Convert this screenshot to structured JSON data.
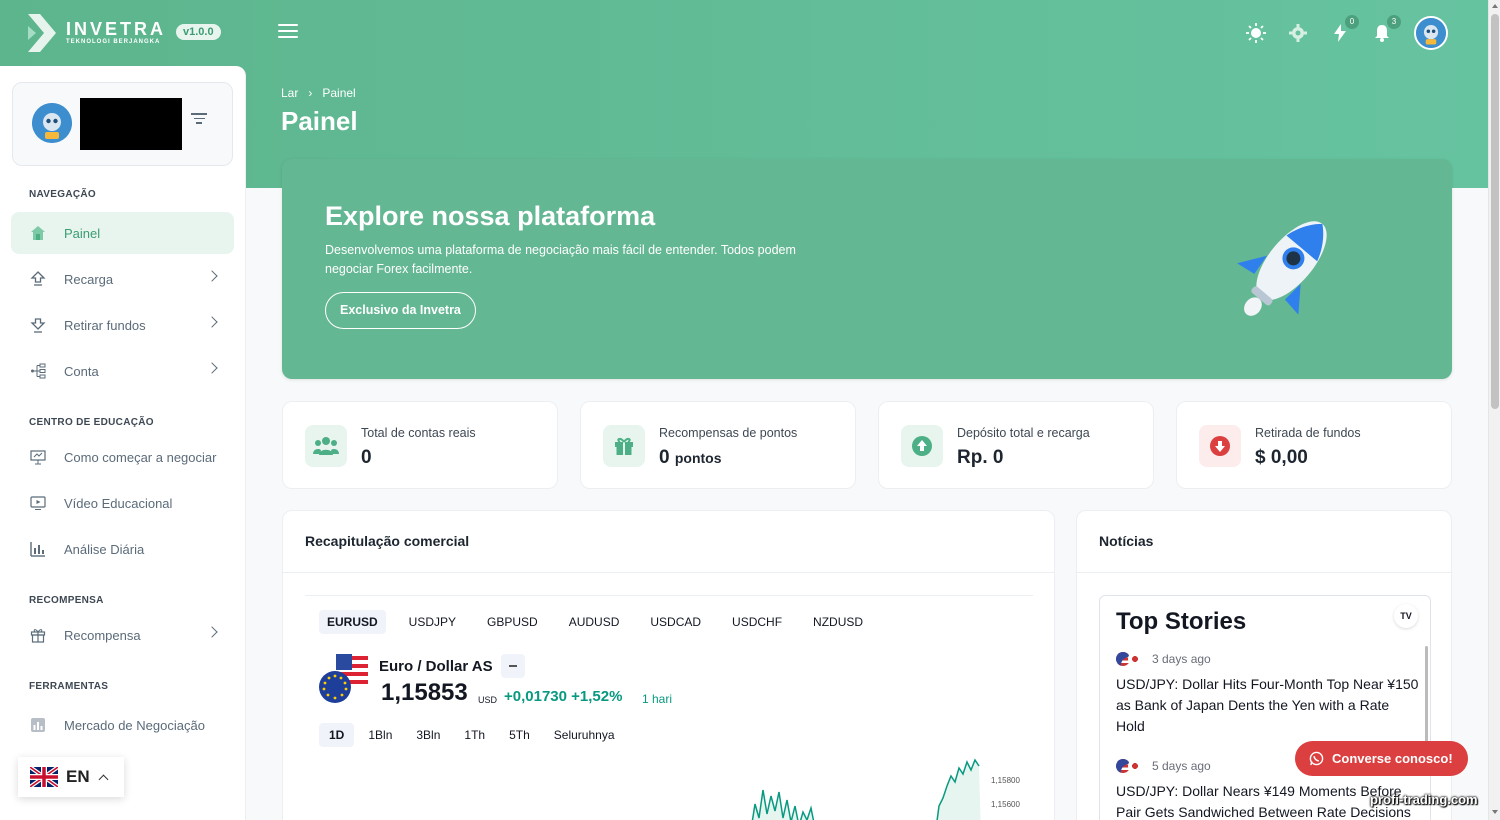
{
  "header": {
    "logo_name": "INVETRA",
    "logo_sub": "TEKNOLOGI BERJANGKA",
    "version": "v1.0.0",
    "notifications_count_1": "0",
    "notifications_count_2": "3"
  },
  "sidebar": {
    "sections": {
      "nav": "NAVEGAÇÃO",
      "education": "CENTRO DE EDUCAÇÃO",
      "reward": "RECOMPENSA",
      "tools": "FERRAMENTAS"
    },
    "items": {
      "painel": "Painel",
      "recarga": "Recarga",
      "retirar": "Retirar fundos",
      "conta": "Conta",
      "como": "Como começar a negociar",
      "video": "Vídeo Educacional",
      "analise": "Análise Diária",
      "recompensa": "Recompensa",
      "mercado": "Mercado de Negociação"
    },
    "language": "EN"
  },
  "breadcrumb": {
    "home": "Lar",
    "current": "Painel"
  },
  "page_title": "Painel",
  "hero": {
    "title": "Explore nossa plataforma",
    "description": "Desenvolvemos uma plataforma de negociação mais fácil de entender. Todos podem negociar Forex facilmente.",
    "button": "Exclusivo da Invetra"
  },
  "stats": [
    {
      "label": "Total de contas reais",
      "value": "0",
      "unit": ""
    },
    {
      "label": "Recompensas de pontos",
      "value": "0",
      "unit": "pontos"
    },
    {
      "label": "Depósito total e recarga",
      "value": "Rp. 0",
      "unit": ""
    },
    {
      "label": "Retirada de fundos",
      "value": "$ 0,00",
      "unit": ""
    }
  ],
  "trade_card": {
    "title": "Recapitulação comercial",
    "symbols": [
      "EURUSD",
      "USDJPY",
      "GBPUSD",
      "AUDUSD",
      "USDCAD",
      "USDCHF",
      "NZDUSD"
    ],
    "pair_name": "Euro / Dollar AS",
    "price": "1,15853",
    "price_unit": "USD",
    "change": "+0,01730 +1,52%",
    "period": "1 hari",
    "ranges": [
      "1D",
      "1Bln",
      "3Bln",
      "1Th",
      "5Th",
      "Seluruhnya"
    ],
    "y_ticks": [
      "1,15800",
      "1,15600"
    ]
  },
  "news_card": {
    "title": "Notícias",
    "widget_title": "Top Stories",
    "stories": [
      {
        "time": "3 days ago",
        "text": "USD/JPY: Dollar Hits Four-Month Top Near ¥150 as Bank of Japan Dents the Yen with a Rate Hold"
      },
      {
        "time": "5 days ago",
        "text": "USD/JPY: Dollar Nears ¥149 Moments Before Pair Gets Sandwiched Between Rate Decisions"
      }
    ]
  },
  "chat_button": "Converse conosco!",
  "watermark": "profi-trading.com",
  "colors": {
    "brand": "#64b793",
    "accent": "#4caf86",
    "danger": "#dc3f3f"
  }
}
